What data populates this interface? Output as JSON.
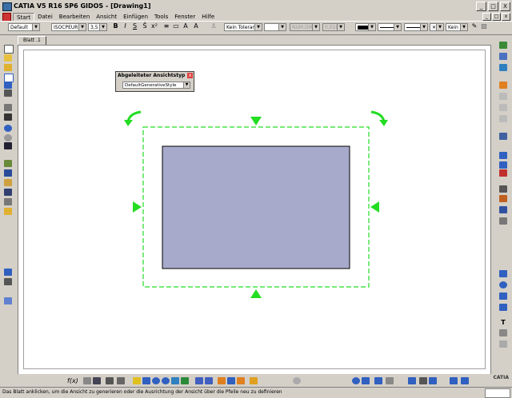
{
  "window": {
    "title": "CATIA V5 R16 SP6 GIDOS - [Drawing1]",
    "controls": [
      "_",
      "□",
      "X"
    ]
  },
  "menubar": {
    "items": [
      "Start",
      "Datei",
      "Bearbeiten",
      "Ansicht",
      "Einfügen",
      "Tools",
      "Fenster",
      "Hilfe"
    ],
    "mdi_controls": [
      "_",
      "□",
      "x"
    ]
  },
  "format_toolbar": {
    "style": "Default",
    "font": "ISOCPEUR (Tr",
    "size": "3,5",
    "bold": "B",
    "italic": "I",
    "underline": "S",
    "tolerance": "Kein Toleranzb",
    "numbering": "NUM.DIMM",
    "precision": "0,010",
    "pattern": "Kein"
  },
  "tabs": [
    {
      "label": "Blatt .1"
    }
  ],
  "dialog": {
    "title": "Abgeleiteter Ansichtstyp",
    "close": "x",
    "selected": "DefaultGenerativeStyle"
  },
  "view": {
    "frame_color": "#22dd22",
    "fill_color": "#a8aacb",
    "border_color": "#000000"
  },
  "status": {
    "message": "Das Blatt anklicken, um die Ansicht zu generieren oder die Ausrichtung der Ansicht über die Pfeile neu zu definieren"
  },
  "brand": {
    "name": "CATIA"
  },
  "icons": {
    "left_toolbar": [
      "new-icon",
      "open-icon",
      "folder-icon",
      "rectangle-icon",
      "table-icon",
      "print-icon",
      "scissors-icon",
      "paste-icon",
      "undo-icon",
      "redo-icon",
      "wizard-icon",
      "sheet-icon",
      "detail-icon",
      "view-icon",
      "grid-icon",
      "tool-icon",
      "truck-icon",
      "snap-icon",
      "layer-icon"
    ],
    "right_toolbar": [
      "front-view-icon",
      "projection-icon",
      "section-icon",
      "detail-view-icon",
      "clipping-icon",
      "broken-view-icon",
      "dimension-icon",
      "text-icon",
      "symbol-icon",
      "geometry-icon",
      "line-icon",
      "circle-icon",
      "spline-icon",
      "table-insert-icon"
    ],
    "bottom_toolbar": [
      "fx-icon",
      "analyze-icon",
      "macro-icon",
      "tools-icon",
      "pan-icon",
      "rotate-icon",
      "zoom-in-icon",
      "zoom-out-icon",
      "fit-icon",
      "normal-view-icon",
      "swap-icon",
      "grid-icon",
      "layer-icon",
      "color-icon",
      "isolate-icon",
      "search-icon",
      "zoom-area-icon",
      "3d-icon",
      "arrow-icon",
      "dimension-icon",
      "check-icon",
      "compass-icon"
    ]
  }
}
